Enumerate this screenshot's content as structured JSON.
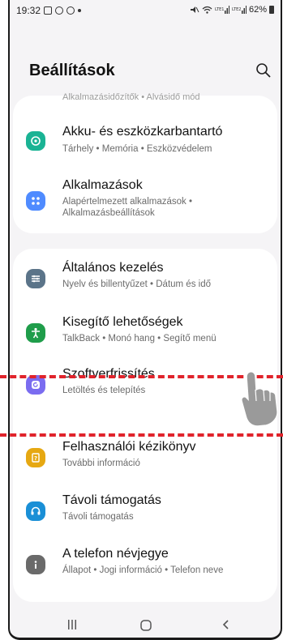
{
  "status_bar": {
    "time": "19:32",
    "right": "62%"
  },
  "header": {
    "title": "Beállítások"
  },
  "group1": {
    "faded_item": "Alkalmazásidőzítők • Alvásidő mód",
    "items": [
      {
        "title": "Akku- és eszközkarbantartó",
        "subtitle": "Tárhely • Memória • Eszközvédelem",
        "icon": "maintenance-icon",
        "color": "#1ab394"
      },
      {
        "title": "Alkalmazások",
        "subtitle": "Alapértelmezett alkalmazások • Alkalmazásbeállítások",
        "icon": "apps-icon",
        "color": "#4f8bff"
      }
    ]
  },
  "group2": {
    "items": [
      {
        "title": "Általános kezelés",
        "subtitle": "Nyelv és billentyűzet • Dátum és idő",
        "icon": "general-management-icon",
        "color": "#5b7489"
      },
      {
        "title": "Kisegítő lehetőségek",
        "subtitle": "TalkBack • Monó hang • Segítő menü",
        "icon": "accessibility-icon",
        "color": "#1f9d4a"
      },
      {
        "title": "Szoftverfrissítés",
        "subtitle": "Letöltés és telepítés",
        "icon": "software-update-icon",
        "color": "#7a6cf0"
      },
      {
        "title": "Felhasználói kézikönyv",
        "subtitle": "További információ",
        "icon": "user-manual-icon",
        "color": "#e6a812"
      },
      {
        "title": "Távoli támogatás",
        "subtitle": "Távoli támogatás",
        "icon": "remote-support-icon",
        "color": "#1a8fd6"
      },
      {
        "title": "A telefon névjegye",
        "subtitle": "Állapot • Jogi információ • Telefon neve",
        "icon": "info-icon",
        "color": "#6a6a6a"
      }
    ]
  },
  "highlight_color": "#e0232b"
}
